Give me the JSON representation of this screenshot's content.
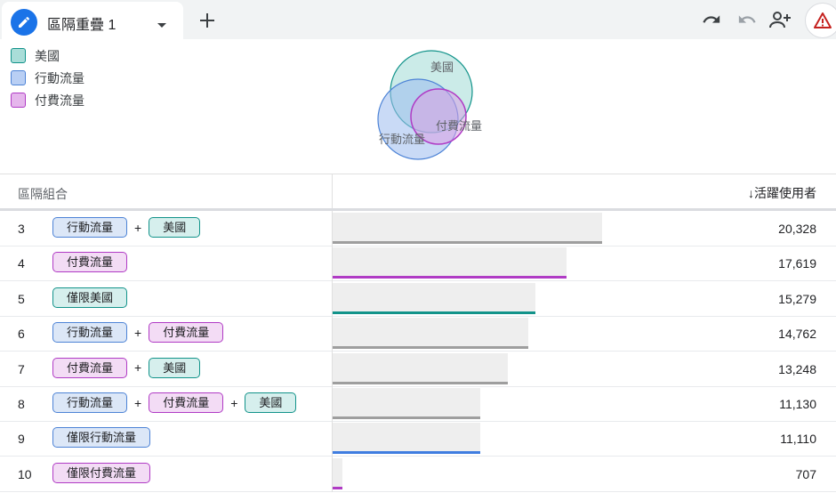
{
  "toolbar": {
    "tab_title": "區隔重疊 1",
    "icons": [
      "edit-icon",
      "dropdown-icon",
      "add-icon",
      "undo-icon",
      "redo-icon",
      "share-icon",
      "warning-icon"
    ]
  },
  "legend": [
    {
      "label": "美國",
      "color": "#12938a",
      "fill": "#a9ddd8"
    },
    {
      "label": "行動流量",
      "color": "#4d83d6",
      "fill": "#b9cff4"
    },
    {
      "label": "付費流量",
      "color": "#b03bc5",
      "fill": "#e5b6ec"
    }
  ],
  "venn": {
    "labels": {
      "us": "美國",
      "mobile": "行動流量",
      "paid": "付費流量"
    }
  },
  "table": {
    "header_left": "區隔組合",
    "header_right": "↓活躍使用者",
    "max_value": 20328,
    "rows": [
      {
        "num": "3",
        "segments": [
          {
            "label": "行動流量",
            "type": "mobile"
          },
          {
            "label": "美國",
            "type": "us"
          }
        ],
        "value": "20,328",
        "value_num": 20328,
        "line": "gray"
      },
      {
        "num": "4",
        "segments": [
          {
            "label": "付費流量",
            "type": "paid"
          }
        ],
        "value": "17,619",
        "value_num": 17619,
        "line": "paid"
      },
      {
        "num": "5",
        "segments": [
          {
            "label": "僅限美國",
            "type": "us"
          }
        ],
        "value": "15,279",
        "value_num": 15279,
        "line": "us"
      },
      {
        "num": "6",
        "segments": [
          {
            "label": "行動流量",
            "type": "mobile"
          },
          {
            "label": "付費流量",
            "type": "paid"
          }
        ],
        "value": "14,762",
        "value_num": 14762,
        "line": "gray"
      },
      {
        "num": "7",
        "segments": [
          {
            "label": "付費流量",
            "type": "paid"
          },
          {
            "label": "美國",
            "type": "us"
          }
        ],
        "value": "13,248",
        "value_num": 13248,
        "line": "gray"
      },
      {
        "num": "8",
        "segments": [
          {
            "label": "行動流量",
            "type": "mobile"
          },
          {
            "label": "付費流量",
            "type": "paid"
          },
          {
            "label": "美國",
            "type": "us"
          }
        ],
        "value": "11,130",
        "value_num": 11130,
        "line": "gray"
      },
      {
        "num": "9",
        "segments": [
          {
            "label": "僅限行動流量",
            "type": "mobile"
          }
        ],
        "value": "11,110",
        "value_num": 11110,
        "line": "mobile"
      },
      {
        "num": "10",
        "segments": [
          {
            "label": "僅限付費流量",
            "type": "paid"
          }
        ],
        "value": "707",
        "value_num": 707,
        "line": "paid"
      }
    ]
  },
  "line_colors": {
    "gray": "#9e9e9e",
    "paid": "#b03bc5",
    "us": "#12938a",
    "mobile": "#3f7de0"
  }
}
